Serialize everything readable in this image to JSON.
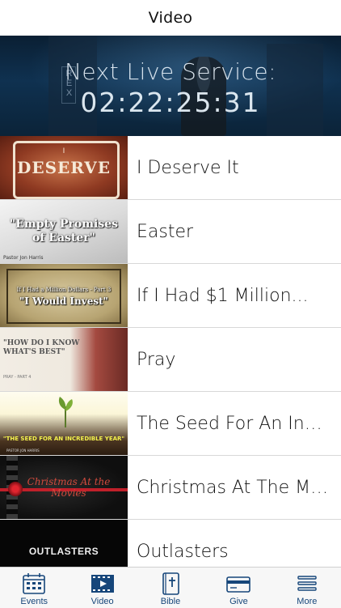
{
  "navbar": {
    "title": "Video"
  },
  "hero": {
    "label": "Next Live Service:",
    "countdown": "02:22:25:31",
    "sign_text": "REX"
  },
  "videos": [
    {
      "title": "I Deserve It",
      "thumb_text": "DESERVE",
      "thumb_sub": "I",
      "thumb_style": "t1"
    },
    {
      "title": "Easter",
      "thumb_text": "\"Empty Promises of Easter\"",
      "thumb_sub": "Pastor Jon Harris",
      "thumb_style": "t2"
    },
    {
      "title": "If I Had $1 Million...",
      "thumb_text": "\"I Would Invest\"",
      "thumb_sub": "If I Had a Million Dollars - Part 3",
      "thumb_style": "t3"
    },
    {
      "title": "Pray",
      "thumb_text": "\"HOW DO I KNOW WHAT'S BEST\"",
      "thumb_sub": "PRAY - PART 4",
      "thumb_style": "t4"
    },
    {
      "title": "The Seed For An Incr...",
      "thumb_text": "\"THE SEED FOR AN INCREDIBLE YEAR\"",
      "thumb_sub": "PASTOR JON HARRIS",
      "thumb_style": "t5"
    },
    {
      "title": "Christmas At The Mo...",
      "thumb_text": "Christmas At the Movies",
      "thumb_sub": "",
      "thumb_style": "t6"
    },
    {
      "title": "Outlasters",
      "thumb_text": "OUTLASTERS",
      "thumb_sub": "",
      "thumb_style": "t7"
    }
  ],
  "tabs": [
    {
      "label": "Events",
      "icon": "calendar-icon"
    },
    {
      "label": "Video",
      "icon": "video-icon"
    },
    {
      "label": "Bible",
      "icon": "bible-icon"
    },
    {
      "label": "Give",
      "icon": "card-icon"
    },
    {
      "label": "More",
      "icon": "menu-icon"
    }
  ],
  "colors": {
    "tab_tint": "#16467a",
    "hero_bg": "#0f3150"
  }
}
